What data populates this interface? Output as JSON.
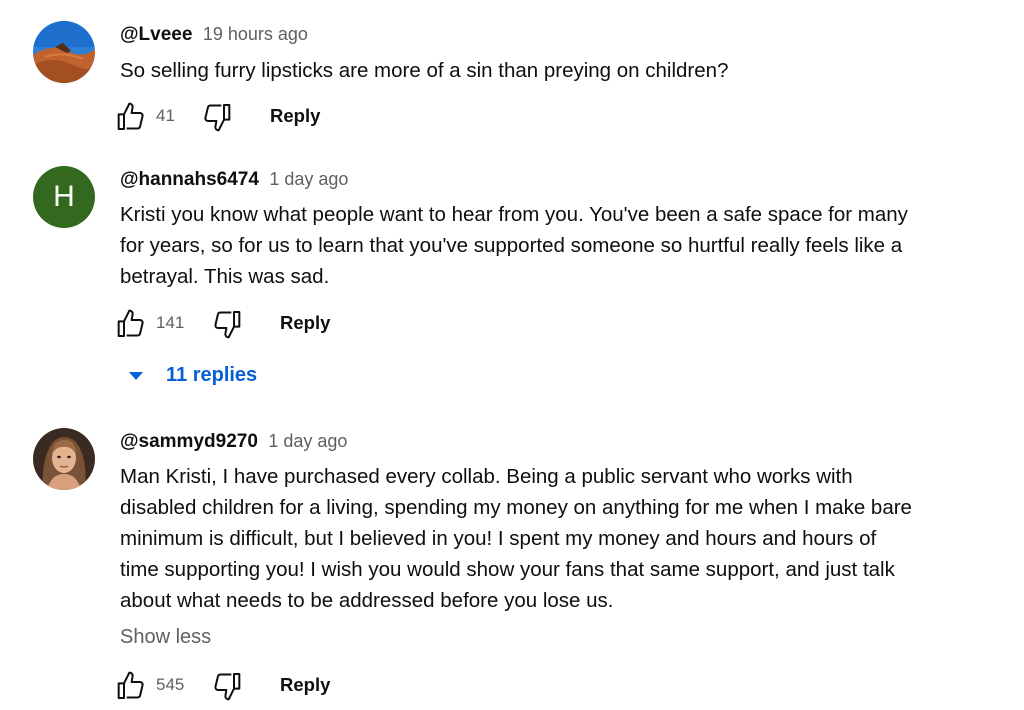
{
  "comments": [
    {
      "author": "@Lveee",
      "time": "19 hours ago",
      "lines": [
        "So selling furry lipsticks are more of a sin than preying on children?"
      ],
      "likes": "41",
      "reply_label": "Reply",
      "avatar": "photo-desert-dunes"
    },
    {
      "author": "@hannahs6474",
      "time": "1 day ago",
      "lines": [
        "Kristi you know what people want to hear from you. You've been a safe space for many",
        "for years, so for us to learn that you've supported someone so hurtful really feels like a",
        "betrayal. This was sad."
      ],
      "likes": "141",
      "reply_label": "Reply",
      "avatar_letter": "H",
      "avatar_color": "#33691e",
      "replies_label": "11 replies"
    },
    {
      "author": "@sammyd9270",
      "time": "1 day ago",
      "lines": [
        "Man Kristi, I have purchased every collab. Being a public servant who works with",
        "disabled children for a living, spending my money on anything for me when I make bare",
        "minimum is difficult, but I believed in you! I spent my money and hours and hours of",
        "time supporting you! I wish you would show your fans that same support, and just talk",
        "about what needs to be addressed before you lose us."
      ],
      "show_less": "Show less",
      "likes": "545",
      "reply_label": "Reply",
      "avatar": "photo-portrait"
    }
  ],
  "colors": {
    "link": "#065fd4",
    "secondary_text": "#606060",
    "primary_text": "#0f0f0f"
  }
}
